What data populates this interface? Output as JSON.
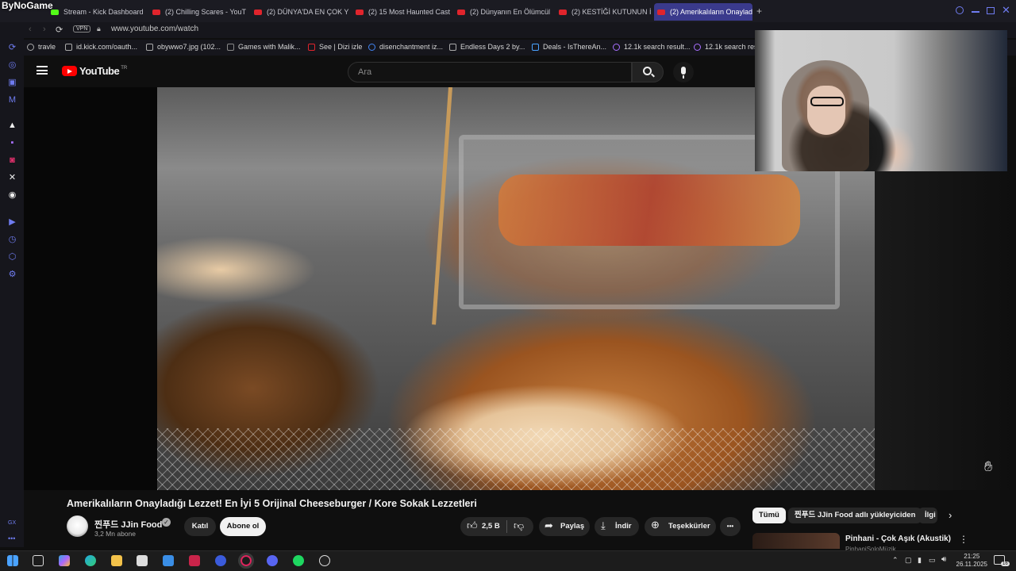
{
  "overlay_logo": "ByNoGame",
  "tabs": [
    {
      "label": "Stream - Kick Dashboard",
      "kind": "kick"
    },
    {
      "label": "(2) Chilling Scares - YouT",
      "kind": "yt"
    },
    {
      "label": "(2) DÜNYA'DA EN ÇOK Y",
      "kind": "yt"
    },
    {
      "label": "(2) 15 Most Haunted Cast",
      "kind": "yt"
    },
    {
      "label": "(2) Dünyanın En Ölümcül",
      "kind": "yt"
    },
    {
      "label": "(2) KESTİĞİ KUTUNUN İÇ",
      "kind": "yt"
    },
    {
      "label": "(2) Amerikalıların Onayladı",
      "kind": "yt",
      "active": true
    }
  ],
  "new_tab": "+",
  "address": {
    "vpn": "VPN",
    "url": "www.youtube.com/watch"
  },
  "bookmarks": [
    "travle",
    "id.kick.com/oauth...",
    "obywwo7.jpg (102...",
    "Games with Malik...",
    "See | Dizi izle",
    "disenchantment iz...",
    "Endless Days 2 by...",
    "Deals - IsThereAn...",
    "12.1k search result...",
    "12.1k search res"
  ],
  "youtube": {
    "logo": "YouTube",
    "region": "TR",
    "search_placeholder": "Ara"
  },
  "video": {
    "title": "Amerikalıların Onayladığı Lezzet! En İyi 5 Orijinal Cheeseburger / Kore Sokak Lezzetleri",
    "channel": "찐푸드 JJin Food",
    "subscribers": "3,2 Mn abone",
    "join": "Katıl",
    "subscribe": "Abone ol",
    "likes": "2,5 B",
    "share": "Paylaş",
    "download": "İndir",
    "thanks": "Teşekkürler",
    "more": "•••"
  },
  "chips": [
    "Tümü",
    "찐푸드 JJin Food adlı yükleyiciden",
    "İlgi"
  ],
  "recommendation": {
    "title": "Pinhani - Çok Aşık (Akustik)",
    "channel": "PinhaniSoloMüzik"
  },
  "taskbar": {
    "time": "21:25",
    "date": "26.11.2025",
    "notif_count": "16"
  },
  "sidebar_label": "GX"
}
